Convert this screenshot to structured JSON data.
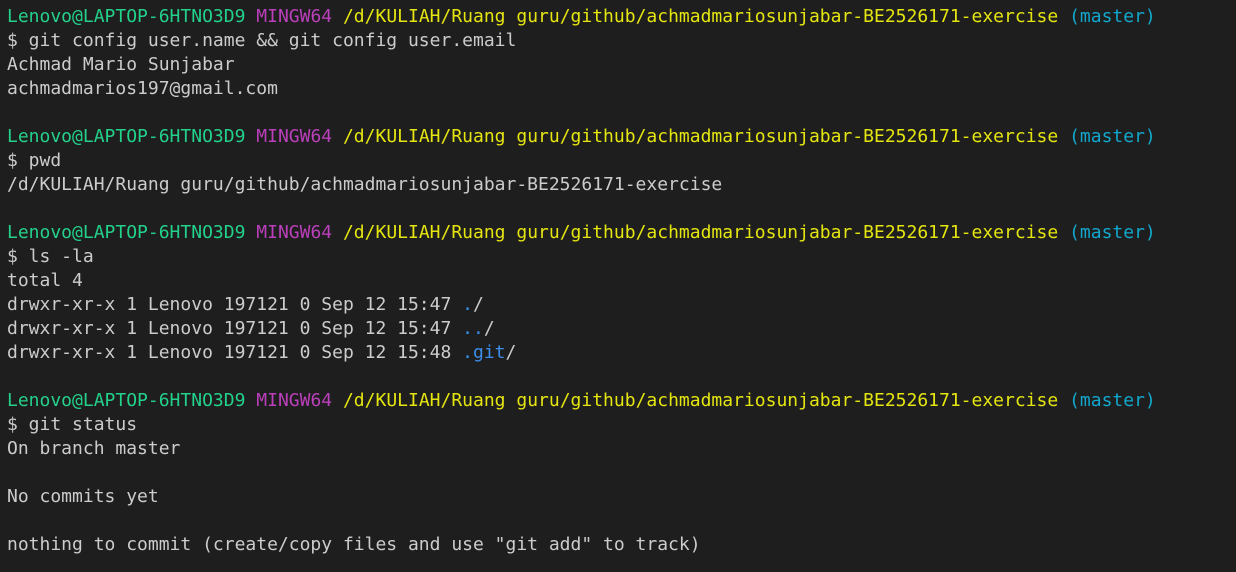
{
  "colors": {
    "background": "#1e1e1e",
    "foreground": "#cccccc",
    "user_host": "#23d18b",
    "msystem": "#bc3fbc",
    "path": "#e5e510",
    "branch": "#11a8cd",
    "directory": "#3b8eea"
  },
  "lines": [
    [
      {
        "text": "Lenovo@LAPTOP-6HTNO3D9",
        "color": "#23d18b"
      },
      {
        "text": " ",
        "color": "#cccccc"
      },
      {
        "text": "MINGW64",
        "color": "#bc3fbc"
      },
      {
        "text": " ",
        "color": "#cccccc"
      },
      {
        "text": "/d/KULIAH/Ruang guru/github/achmadmariosunjabar-BE2526171-exercise",
        "color": "#e5e510"
      },
      {
        "text": " ",
        "color": "#cccccc"
      },
      {
        "text": "(master)",
        "color": "#11a8cd"
      }
    ],
    [
      {
        "text": "$ git config user.name && git config user.email",
        "color": "#cccccc"
      }
    ],
    [
      {
        "text": "Achmad Mario Sunjabar",
        "color": "#cccccc"
      }
    ],
    [
      {
        "text": "achmadmarios197@gmail.com",
        "color": "#cccccc"
      }
    ],
    [],
    [
      {
        "text": "Lenovo@LAPTOP-6HTNO3D9",
        "color": "#23d18b"
      },
      {
        "text": " ",
        "color": "#cccccc"
      },
      {
        "text": "MINGW64",
        "color": "#bc3fbc"
      },
      {
        "text": " ",
        "color": "#cccccc"
      },
      {
        "text": "/d/KULIAH/Ruang guru/github/achmadmariosunjabar-BE2526171-exercise",
        "color": "#e5e510"
      },
      {
        "text": " ",
        "color": "#cccccc"
      },
      {
        "text": "(master)",
        "color": "#11a8cd"
      }
    ],
    [
      {
        "text": "$ pwd",
        "color": "#cccccc"
      }
    ],
    [
      {
        "text": "/d/KULIAH/Ruang guru/github/achmadmariosunjabar-BE2526171-exercise",
        "color": "#cccccc"
      }
    ],
    [],
    [
      {
        "text": "Lenovo@LAPTOP-6HTNO3D9",
        "color": "#23d18b"
      },
      {
        "text": " ",
        "color": "#cccccc"
      },
      {
        "text": "MINGW64",
        "color": "#bc3fbc"
      },
      {
        "text": " ",
        "color": "#cccccc"
      },
      {
        "text": "/d/KULIAH/Ruang guru/github/achmadmariosunjabar-BE2526171-exercise",
        "color": "#e5e510"
      },
      {
        "text": " ",
        "color": "#cccccc"
      },
      {
        "text": "(master)",
        "color": "#11a8cd"
      }
    ],
    [
      {
        "text": "$ ls -la",
        "color": "#cccccc"
      }
    ],
    [
      {
        "text": "total 4",
        "color": "#cccccc"
      }
    ],
    [
      {
        "text": "drwxr-xr-x 1 Lenovo 197121 0 Sep 12 15:47 ",
        "color": "#cccccc"
      },
      {
        "text": ".",
        "color": "#3b8eea"
      },
      {
        "text": "/",
        "color": "#cccccc"
      }
    ],
    [
      {
        "text": "drwxr-xr-x 1 Lenovo 197121 0 Sep 12 15:47 ",
        "color": "#cccccc"
      },
      {
        "text": "..",
        "color": "#3b8eea"
      },
      {
        "text": "/",
        "color": "#cccccc"
      }
    ],
    [
      {
        "text": "drwxr-xr-x 1 Lenovo 197121 0 Sep 12 15:48 ",
        "color": "#cccccc"
      },
      {
        "text": ".git",
        "color": "#3b8eea"
      },
      {
        "text": "/",
        "color": "#cccccc"
      }
    ],
    [],
    [
      {
        "text": "Lenovo@LAPTOP-6HTNO3D9",
        "color": "#23d18b"
      },
      {
        "text": " ",
        "color": "#cccccc"
      },
      {
        "text": "MINGW64",
        "color": "#bc3fbc"
      },
      {
        "text": " ",
        "color": "#cccccc"
      },
      {
        "text": "/d/KULIAH/Ruang guru/github/achmadmariosunjabar-BE2526171-exercise",
        "color": "#e5e510"
      },
      {
        "text": " ",
        "color": "#cccccc"
      },
      {
        "text": "(master)",
        "color": "#11a8cd"
      }
    ],
    [
      {
        "text": "$ git status",
        "color": "#cccccc"
      }
    ],
    [
      {
        "text": "On branch master",
        "color": "#cccccc"
      }
    ],
    [],
    [
      {
        "text": "No commits yet",
        "color": "#cccccc"
      }
    ],
    [],
    [
      {
        "text": "nothing to commit (create/copy files and use \"git add\" to track)",
        "color": "#cccccc"
      }
    ]
  ]
}
